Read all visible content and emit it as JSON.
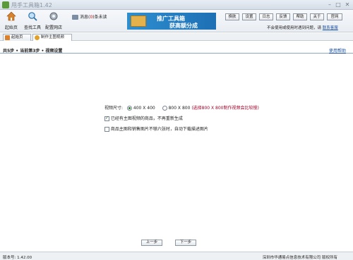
{
  "window": {
    "title": "甩手工具箱1.42",
    "min": "–",
    "max": "□",
    "close": "✕"
  },
  "toolbar": {
    "tools": [
      {
        "label": "起始页",
        "icon": "home-icon"
      },
      {
        "label": "查找工具",
        "icon": "search-icon"
      },
      {
        "label": "配置网店",
        "icon": "gear-icon"
      }
    ],
    "messages": {
      "prefix": "消息(",
      "count": "0",
      "suffix": ")条未读"
    },
    "banner": {
      "line1": "推广工具箱",
      "line2": "获高额分成"
    },
    "nav_buttons": [
      "换肤",
      "设置",
      "日志",
      "反馈",
      "帮助",
      "关于",
      "官网"
    ],
    "help_text": "不会使用或使用时遇到问题，请",
    "help_link": "联系客服"
  },
  "tabs": [
    {
      "label": "起始页",
      "icon": "home-icon",
      "active": false
    },
    {
      "label": "制作主图视频",
      "icon": "video-icon",
      "active": true
    }
  ],
  "steps": {
    "text": "共5步 • 当前第3步 • 视频设置",
    "help_link": "使用帮助"
  },
  "form": {
    "size_label": "视频尺寸:",
    "options": [
      {
        "label": "400 X 400",
        "selected": true
      },
      {
        "label": "800 X 800",
        "selected": false
      }
    ],
    "size_note": "(选择800 X 800制作视频会比较慢)",
    "checkboxes": [
      {
        "label": "已经有主图视频的商品，不再重新生成",
        "checked": true
      },
      {
        "label": "商品主图和销售图片不够六张时，自动下载描述图片",
        "checked": false
      }
    ]
  },
  "buttons": {
    "prev": "上一步",
    "next": "下一步"
  },
  "status": {
    "version": "版本号: 1.42.00",
    "company": "深圳市华通易点信息技术有限公司 版权所有"
  },
  "colors": {
    "accent": "#1e6fb4",
    "warning": "#a0002a"
  }
}
